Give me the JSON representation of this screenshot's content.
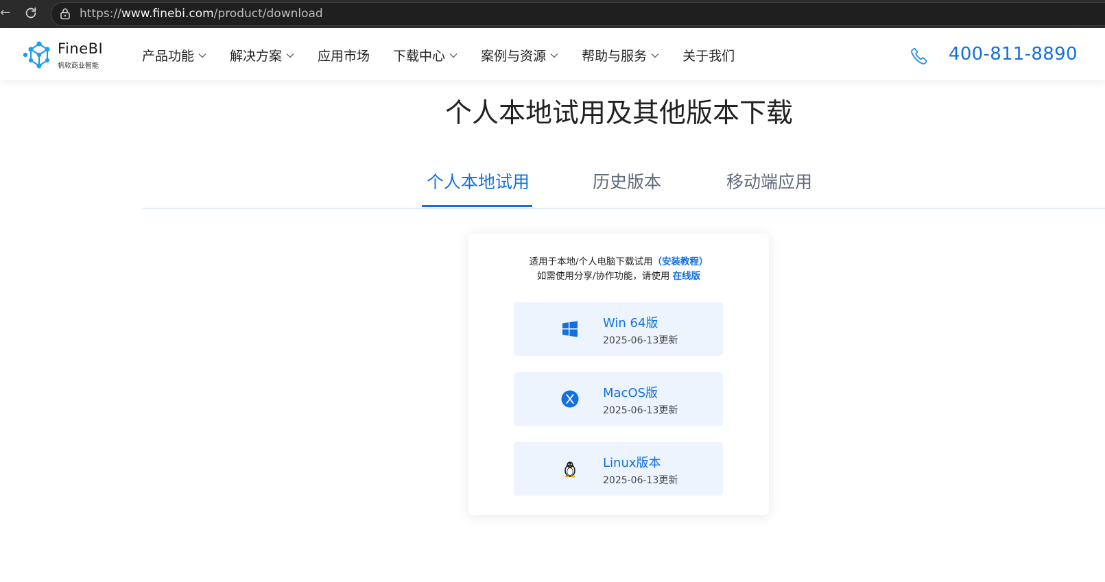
{
  "browser": {
    "url_prefix": "https://",
    "url_host": "www.finebi.com",
    "url_path": "/product/download"
  },
  "header": {
    "logo_name": "FineBI",
    "logo_sub": "帆软商业智能",
    "nav": [
      {
        "label": "产品功能",
        "dropdown": true
      },
      {
        "label": "解决方案",
        "dropdown": true
      },
      {
        "label": "应用市场",
        "dropdown": false
      },
      {
        "label": "下载中心",
        "dropdown": true
      },
      {
        "label": "案例与资源",
        "dropdown": true
      },
      {
        "label": "帮助与服务",
        "dropdown": true
      },
      {
        "label": "关于我们",
        "dropdown": false
      }
    ],
    "phone": "400-811-8890",
    "accent_color": "#1370e0"
  },
  "main": {
    "title": "个人本地试用及其他版本下载",
    "tabs": [
      "个人本地试用",
      "历史版本",
      "移动端应用"
    ],
    "active_tab": 0,
    "card": {
      "note_line1": "适用于本地/个人电脑下载试用",
      "note_link1": "（安装教程）",
      "note_line2": "如需使用分享/协作功能，请使用 ",
      "note_link2": "在线版",
      "downloads": [
        {
          "name": "Win 64版",
          "date": "2025-06-13更新",
          "icon": "windows-icon"
        },
        {
          "name": "MacOS版",
          "date": "2025-06-13更新",
          "icon": "macos-icon"
        },
        {
          "name": "Linux版本",
          "date": "2025-06-13更新",
          "icon": "linux-icon"
        }
      ]
    }
  }
}
